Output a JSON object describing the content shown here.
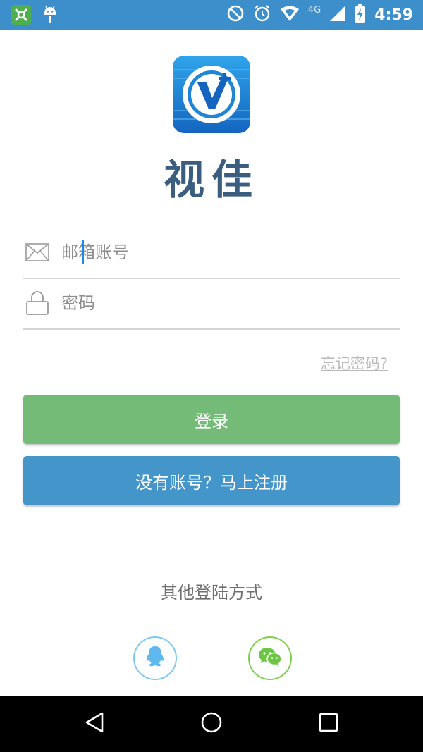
{
  "status_bar": {
    "network": "4G",
    "time": "4:59"
  },
  "brand": {
    "name": "视佳"
  },
  "login_form": {
    "email_placeholder": "邮箱账号",
    "password_placeholder": "密码",
    "forgot_label": "忘记密码?",
    "login_label": "登录",
    "register_label": "没有账号？马上注册"
  },
  "social": {
    "divider_label": "其他登陆方式",
    "options": [
      "qq-icon",
      "wechat-icon"
    ]
  },
  "colors": {
    "status_bar": "#3d8fcb",
    "login_button": "#74bb77",
    "register_button": "#4496ca",
    "brand_text": "#3b5d80"
  }
}
